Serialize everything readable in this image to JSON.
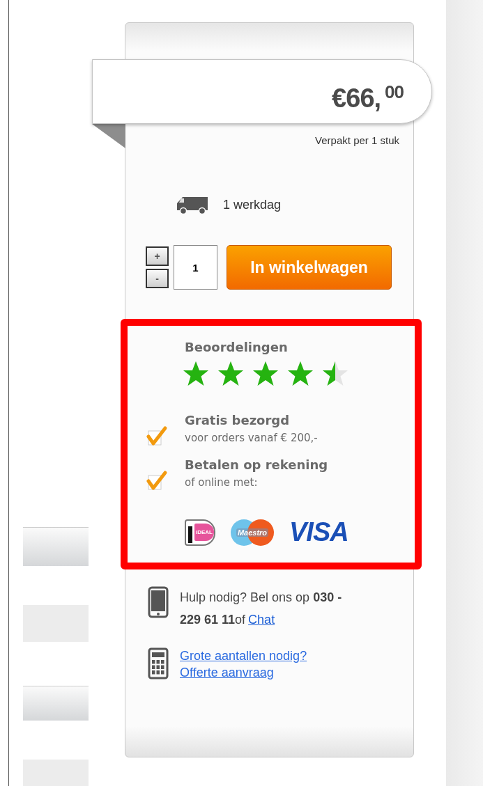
{
  "price": {
    "main": "€66,",
    "cents": "00"
  },
  "packaging": "Verpakt per 1 stuk",
  "delivery": "1 werkdag",
  "quantity": {
    "plus": "+",
    "minus": "-",
    "value": "1"
  },
  "cart_button": "In winkelwagen",
  "reviews": {
    "title": "Beoordelingen",
    "stars": 4.5
  },
  "benefits": [
    {
      "title": "Gratis bezorgd",
      "subtitle": "voor orders vanaf € 200,-",
      "checked": true
    },
    {
      "title": "Betalen op rekening",
      "subtitle": "of online met:",
      "checked": true
    }
  ],
  "payment_methods": [
    {
      "kind": "ideal",
      "label": "iDEAL"
    },
    {
      "kind": "maestro",
      "label": "Maestro"
    },
    {
      "kind": "visa",
      "label": "VISA"
    }
  ],
  "help": {
    "text": "Hulp nodig? Bel ons op **030 - 229 61 11**of",
    "link": "Chat"
  },
  "bulk_link": "Grote aantallen nodig? Offerte aanvraag"
}
